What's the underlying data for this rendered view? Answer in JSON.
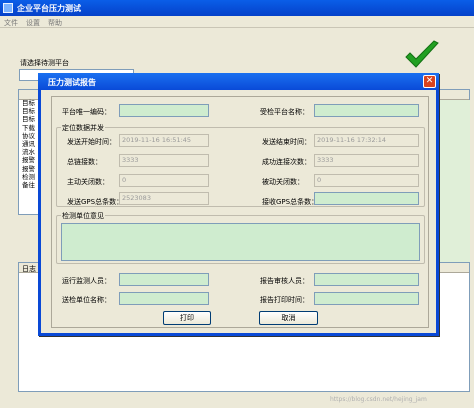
{
  "main_window": {
    "title": "企业平台压力测试",
    "menu": [
      "文件",
      "设置",
      "帮助"
    ],
    "select_label": "请选择待测平台",
    "list_items": [
      "目标",
      "目标",
      "目标",
      "下载",
      "协议",
      "通讯",
      "流水",
      "报警",
      "报警",
      "检测",
      "备往"
    ],
    "lower_header": "日志",
    "watermark": "https://blog.csdn.net/hejing_jam"
  },
  "dialog": {
    "title": "压力测试报告",
    "close": "✕",
    "platform_code_label": "平台唯一编码：",
    "platform_name_label": "受检平台名称：",
    "group_positioning": "定位数据并发",
    "send_start_label": "发送开始时间：",
    "send_start_value": "2019-11-16 16:51:45",
    "send_end_label": "发送结束时间：",
    "send_end_value": "2019-11-16 17:32:14",
    "total_links_label": "总链接数：",
    "total_links_value": "3333",
    "success_links_label": "成功连接次数：",
    "success_links_value": "3333",
    "active_close_label": "主动关闭数：",
    "active_close_value": "0",
    "passive_close_label": "被动关闭数：",
    "passive_close_value": "0",
    "gps_sent_label": "发送GPS总条数：",
    "gps_sent_value": "2523083",
    "gps_recv_label": "接收GPS总条数：",
    "group_opinion": "检测单位意见",
    "operator_label": "运行监测人员：",
    "reviewer_label": "报告审核人员：",
    "submitter_label": "送检单位名称：",
    "print_person_label": "报告打印时间：",
    "print_button": "打印",
    "cancel_button": "取消"
  }
}
